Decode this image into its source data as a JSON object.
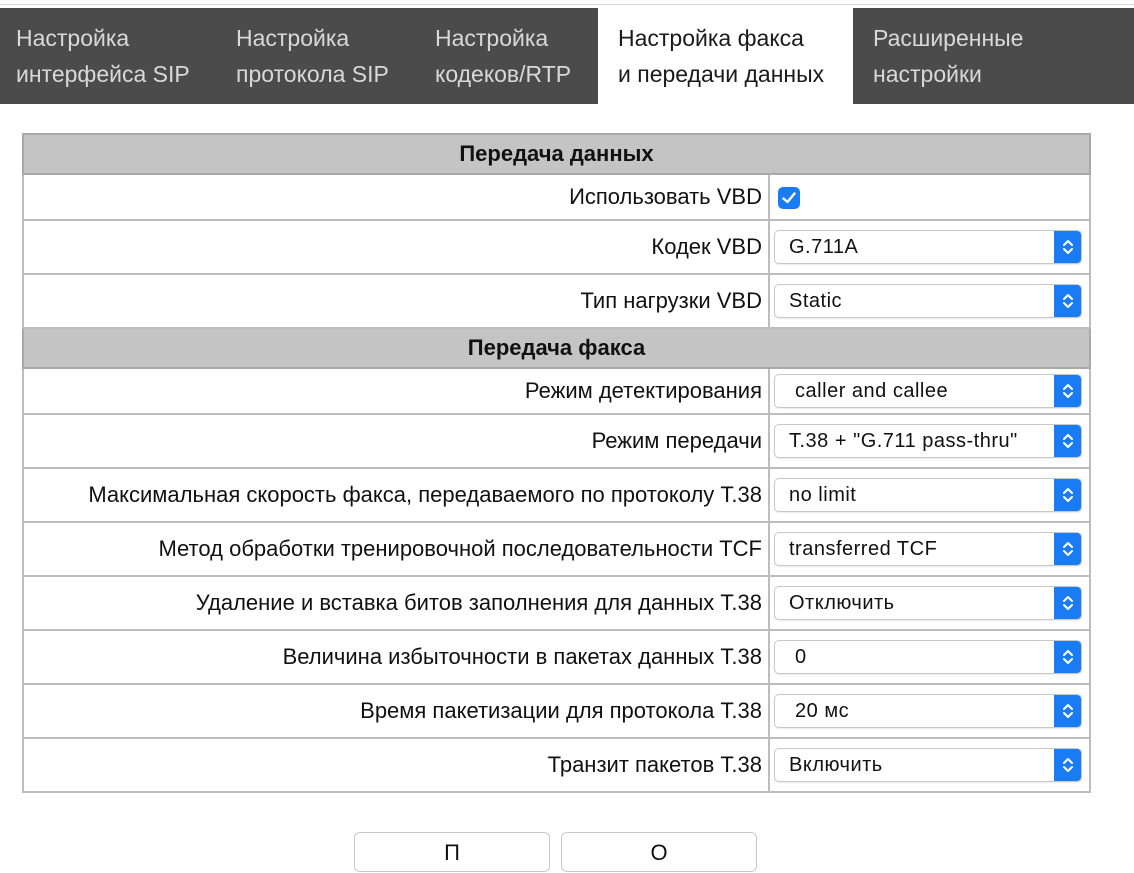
{
  "tabs": [
    {
      "line1": "Настройка",
      "line2": "интерфейса SIP",
      "active": false
    },
    {
      "line1": "Настройка",
      "line2": "протокола SIP",
      "active": false
    },
    {
      "line1": "Настройка",
      "line2": "кодеков/RTP",
      "active": false
    },
    {
      "line1": "Настройка факса",
      "line2": "и передачи данных",
      "active": true
    },
    {
      "line1": "Расширенные",
      "line2": "настройки",
      "active": false
    }
  ],
  "sections": {
    "data": "Передача данных",
    "fax": "Передача факса"
  },
  "fields": {
    "use_vbd": {
      "label": "Использовать VBD",
      "checked": true
    },
    "vbd_codec": {
      "label": "Кодек VBD",
      "value": "G.711A"
    },
    "vbd_payload": {
      "label": "Тип нагрузки VBD",
      "value": "Static"
    },
    "detect_mode": {
      "label": "Режим детектирования",
      "value": " caller and callee"
    },
    "transfer_mode": {
      "label": "Режим передачи",
      "value": "T.38 + \"G.711 pass-thru\""
    },
    "max_fax_speed": {
      "label": "Максимальная скорость факса, передаваемого по протоколу Т.38",
      "value": "no limit"
    },
    "tcf_method": {
      "label": "Метод обработки тренировочной последовательности TCF",
      "value": "transferred TCF"
    },
    "fill_bits": {
      "label": "Удаление и вставка битов заполнения для данных Т.38",
      "value": "Отключить"
    },
    "redundancy": {
      "label": "Величина избыточности в пакетах данных Т.38",
      "value": " 0"
    },
    "packetization": {
      "label": "Время пакетизации для протокола Т.38",
      "value": " 20 мс"
    },
    "transit": {
      "label": "Транзит пакетов Т.38",
      "value": "Включить"
    }
  },
  "buttons": {
    "apply_visible": "П",
    "cancel_visible": "О"
  },
  "colors": {
    "tab_bg": "#4b4b4b",
    "accent": "#1a7cf5",
    "section_bg": "#c4c4c4"
  }
}
